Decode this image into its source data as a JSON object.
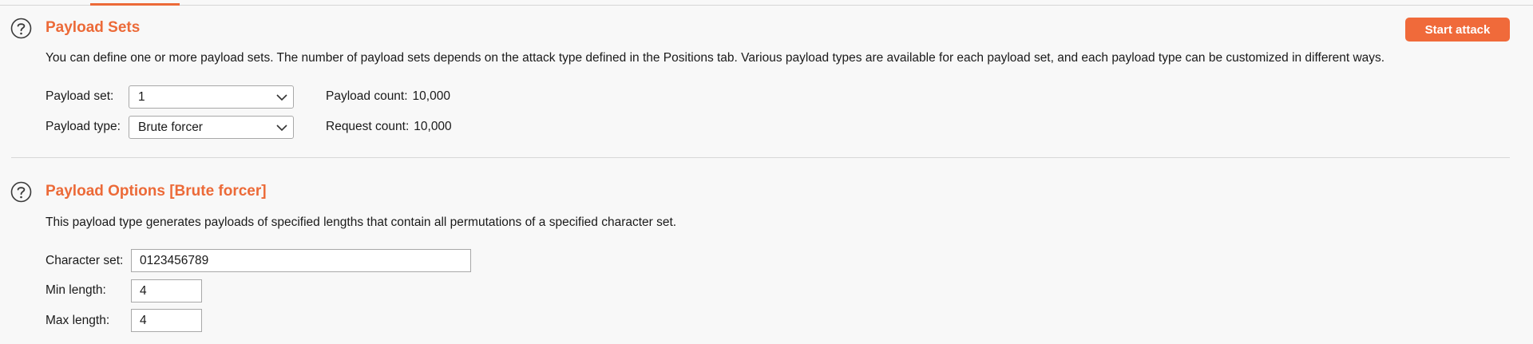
{
  "payload_sets": {
    "title": "Payload Sets",
    "description": "You can define one or more payload sets. The number of payload sets depends on the attack type defined in the Positions tab. Various payload types are available for each payload set, and each payload type can be customized in different ways.",
    "start_attack_label": "Start attack",
    "payload_set_label": "Payload set:",
    "payload_set_value": "1",
    "payload_type_label": "Payload type:",
    "payload_type_value": "Brute forcer",
    "payload_count_label": "Payload count:",
    "payload_count_value": "10,000",
    "request_count_label": "Request count:",
    "request_count_value": "10,000"
  },
  "payload_options": {
    "title": "Payload Options [Brute forcer]",
    "description": "This payload type generates payloads of specified lengths that contain all permutations of a specified character set.",
    "character_set_label": "Character set:",
    "character_set_value": "0123456789",
    "min_length_label": "Min length:",
    "min_length_value": "4",
    "max_length_label": "Max length:",
    "max_length_value": "4"
  },
  "colors": {
    "accent": "#ec6a38",
    "button": "#f06a3a",
    "background": "#f8f8f8"
  },
  "icons": {
    "help": "question-circle-icon",
    "dropdown": "chevron-down-icon"
  }
}
